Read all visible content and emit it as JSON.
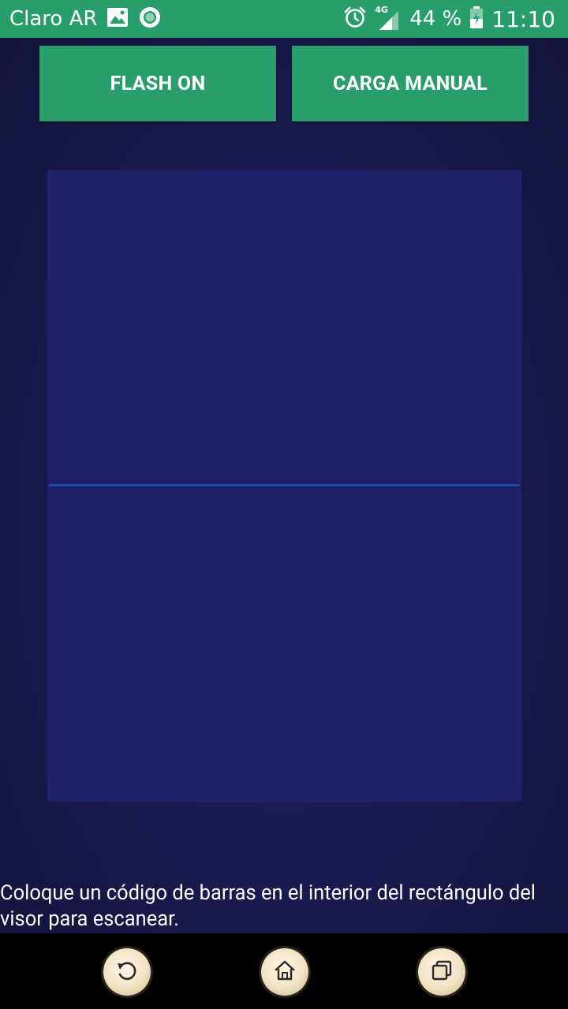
{
  "status_bar": {
    "carrier": "Claro AR",
    "network_type": "4G",
    "battery_percent": "44 %",
    "time": "11:10",
    "icons": [
      "image-icon",
      "record-icon",
      "alarm-icon",
      "signal-icon",
      "battery-icon"
    ]
  },
  "actions": {
    "flash_label": "FLASH ON",
    "manual_label": "CARGA MANUAL"
  },
  "scanner": {
    "hint": "Coloque un código de barras en el interior del rectángulo del visor para escanear."
  },
  "nav_bar": {
    "icons": [
      "back-icon",
      "home-icon",
      "recent-apps-icon"
    ]
  },
  "colors": {
    "accent": "#289e6a",
    "viewfinder": "#201f6a",
    "scan_line": "#1e4a9c"
  }
}
